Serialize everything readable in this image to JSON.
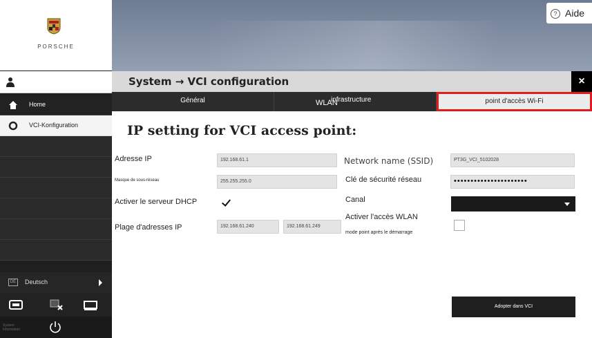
{
  "brand": {
    "name": "PORSCHE"
  },
  "header": {
    "help_label": "Aide"
  },
  "window": {
    "title": "System → VCI configuration",
    "close_label": "×"
  },
  "sidebar": {
    "items": [
      {
        "label": "Home",
        "icon": "home-icon"
      },
      {
        "label": "VCI-Konfiguration",
        "icon": "ring-icon"
      }
    ],
    "language": "Deutsch",
    "language_flag": "DE",
    "footer_text": "System Information"
  },
  "tabs": [
    {
      "label": "Général"
    },
    {
      "label_a": "WLAN",
      "label_b": "infrastructure"
    },
    {
      "label": "point d'accès Wi-Fi",
      "active": true
    }
  ],
  "form": {
    "heading": "IP setting for VCI access point:",
    "ip_label": "Adresse IP",
    "ip_value": "192.168.61.1",
    "mask_label": "Masque de sous-réseau",
    "mask_value": "255.255.255.0",
    "dhcp_label": "Activer le serveur DHCP",
    "dhcp_checked": true,
    "range_label": "Plage d'adresses IP",
    "range_start": "192.168.61.240",
    "range_end": "192.168.61.249",
    "ssid_label": "Network name (SSID)",
    "ssid_value": "PT3G_VCI_5102028",
    "key_label": "Clé de sécurité réseau",
    "key_value": "••••••••••••••••••••••",
    "channel_label": "Canal",
    "channel_value": "",
    "wlan_label": "Activer l'accès WLAN",
    "wlan_sub_label": "mode point après le démarrage",
    "wlan_checked": false,
    "apply_label": "Adopter dans VCI"
  },
  "colors": {
    "accent": "#e31b1b",
    "sidebar": "#1f1f1f",
    "header": "#7f8ca1"
  }
}
